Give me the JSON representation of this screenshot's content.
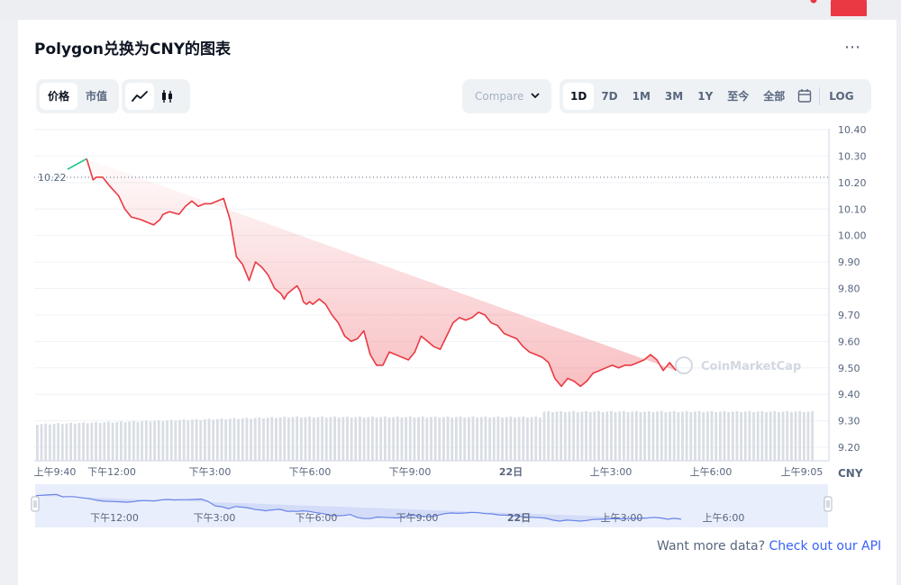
{
  "title": "Polygon兑换为CNY的图表",
  "more_icon": "⋯",
  "metric_tabs": [
    {
      "label": "价格",
      "active": true
    },
    {
      "label": "市值",
      "active": false
    }
  ],
  "chart_type_tabs": [
    {
      "icon": "line-chart-icon",
      "active": true
    },
    {
      "icon": "candlestick-icon",
      "active": false
    }
  ],
  "compare": {
    "label": "Compare with"
  },
  "range_tabs": [
    {
      "label": "1D",
      "active": true
    },
    {
      "label": "7D",
      "active": false
    },
    {
      "label": "1M",
      "active": false
    },
    {
      "label": "3M",
      "active": false
    },
    {
      "label": "1Y",
      "active": false
    },
    {
      "label": "至今",
      "active": false
    },
    {
      "label": "全部",
      "active": false
    }
  ],
  "log_label": "LOG",
  "footer": {
    "text": "Want more data?",
    "link": "Check out our API"
  },
  "watermark": "CoinMarketCap",
  "colors": {
    "up": "#16c784",
    "down": "#ea3943",
    "text": "#58667e",
    "accent": "#3861fb",
    "navigator": "#6883e8"
  },
  "chart_data": {
    "type": "line",
    "currency": "CNY",
    "open_value": "10.22",
    "last_value": "9.49",
    "ylim": [
      9.15,
      10.42
    ],
    "y_ticks": [
      "10.40",
      "10.30",
      "10.20",
      "10.10",
      "10.00",
      "9.90",
      "9.80",
      "9.70",
      "9.60",
      "9.50",
      "9.40",
      "9.30",
      "9.20"
    ],
    "x_ticks": [
      "上午9:40",
      "下午12:00",
      "下午3:00",
      "下午6:00",
      "下午9:00",
      "22日",
      "上午3:00",
      "上午6:00",
      "上午9:05"
    ],
    "navigator_ticks": [
      "下午12:00",
      "下午3:00",
      "下午6:00",
      "下午9:00",
      "22日",
      "上午3:00",
      "上午6:00"
    ],
    "x_hours": [
      0,
      0.3,
      0.6,
      0.8,
      0.9,
      1.1,
      1.3,
      1.6,
      1.8,
      2.0,
      2.3,
      2.5,
      2.7,
      2.9,
      3.0,
      3.2,
      3.5,
      3.7,
      3.9,
      4.1,
      4.3,
      4.5,
      4.7,
      4.9,
      5.1,
      5.3,
      5.5,
      5.7,
      5.9,
      6.1,
      6.3,
      6.5,
      6.7,
      6.8,
      6.9,
      7.0,
      7.1,
      7.2,
      7.3,
      7.4,
      7.5,
      7.6,
      7.7,
      7.9,
      8.1,
      8.3,
      8.5,
      8.7,
      8.9,
      9.1,
      9.3,
      9.5,
      9.7,
      9.9,
      10.1,
      10.3,
      10.5,
      10.7,
      10.9,
      11.1,
      11.3,
      11.5,
      11.7,
      11.9,
      12.1,
      12.3,
      12.5,
      12.7,
      12.9,
      13.1,
      13.3,
      13.5,
      13.7,
      13.9,
      14.1,
      14.3,
      14.5,
      14.7,
      14.9,
      15.1,
      15.3,
      15.5,
      15.7,
      15.9,
      16.1,
      16.3,
      16.5,
      16.7,
      16.9,
      17.1,
      17.3,
      17.5,
      17.7,
      17.9,
      18.1,
      18.3,
      18.5,
      18.7,
      18.9,
      19.1,
      19.3,
      19.5,
      19.7,
      19.9,
      20.1,
      20.3,
      20.5,
      20.7,
      20.9,
      21.1,
      21.3,
      21.5,
      21.7,
      21.9,
      22.1,
      22.3,
      22.5,
      22.7,
      22.9,
      23.1,
      23.3,
      23.42
    ],
    "values": [
      10.25,
      10.27,
      10.29,
      10.21,
      10.22,
      10.22,
      10.19,
      10.15,
      10.1,
      10.07,
      10.06,
      10.05,
      10.04,
      10.06,
      10.08,
      10.09,
      10.08,
      10.11,
      10.13,
      10.11,
      10.12,
      10.12,
      10.13,
      10.14,
      10.06,
      9.92,
      9.89,
      9.83,
      9.9,
      9.88,
      9.85,
      9.8,
      9.78,
      9.76,
      9.78,
      9.79,
      9.8,
      9.81,
      9.79,
      9.75,
      9.74,
      9.75,
      9.74,
      9.76,
      9.74,
      9.7,
      9.67,
      9.62,
      9.6,
      9.61,
      9.64,
      9.55,
      9.51,
      9.51,
      9.56,
      9.55,
      9.54,
      9.53,
      9.56,
      9.62,
      9.6,
      9.58,
      9.57,
      9.62,
      9.67,
      9.69,
      9.68,
      9.69,
      9.71,
      9.7,
      9.67,
      9.66,
      9.63,
      9.62,
      9.61,
      9.58,
      9.56,
      9.55,
      9.54,
      9.52,
      9.46,
      9.43,
      9.46,
      9.45,
      9.43,
      9.45,
      9.48,
      9.49,
      9.5,
      9.51,
      9.5,
      9.51,
      9.51,
      9.52,
      9.53,
      9.55,
      9.53,
      9.49,
      9.52,
      9.49
    ],
    "volume_note": ""
  }
}
